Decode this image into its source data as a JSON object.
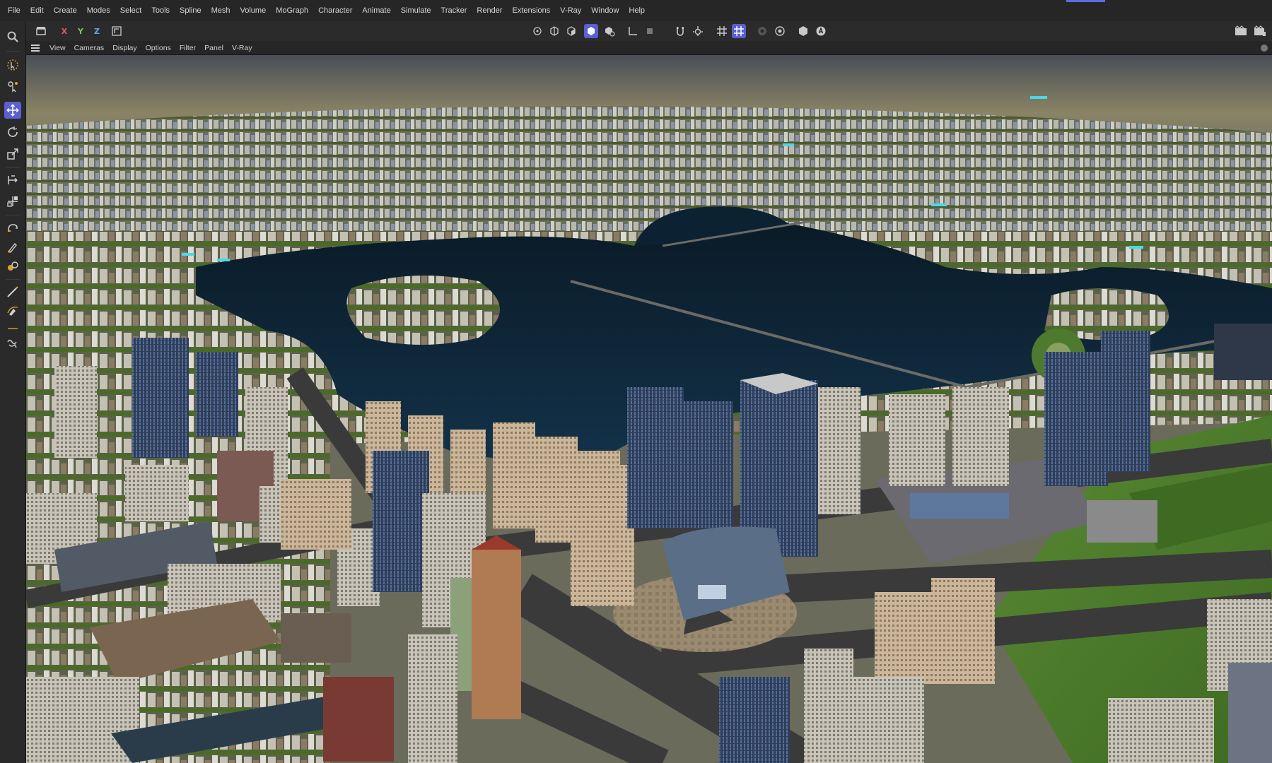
{
  "menu": [
    "File",
    "Edit",
    "Create",
    "Modes",
    "Select",
    "Tools",
    "Spline",
    "Mesh",
    "Volume",
    "MoGraph",
    "Character",
    "Animate",
    "Simulate",
    "Tracker",
    "Render",
    "Extensions",
    "V-Ray",
    "Window",
    "Help"
  ],
  "toolbar": {
    "axis_x": "X",
    "axis_y": "Y",
    "axis_z": "Z",
    "axis_colors": {
      "x": "#e05a5a",
      "y": "#7fc45a",
      "z": "#6aa3e6"
    },
    "icons_left": [
      "search-icon",
      "undo-icon",
      "coordinate-system-icon"
    ],
    "icons_center": [
      "points-mode-icon",
      "edges-mode-icon",
      "polygons-mode-icon",
      "object-mode-icon",
      "texture-mode-icon",
      "axis-mode-icon",
      "solo-icon",
      "enable-snap-icon",
      "snap-settings-icon",
      "grid-icon",
      "workplane-icon",
      "render-region-icon",
      "render-settings-icon",
      "vray-icon",
      "vray-render-icon"
    ],
    "icons_right": [
      "render-view-icon",
      "render-queue-icon"
    ]
  },
  "viewport_menu": [
    "View",
    "Cameras",
    "Display",
    "Options",
    "Filter",
    "Panel",
    "V-Ray"
  ],
  "sidebar_tools": [
    "live-selection-icon",
    "selection-tools-icon",
    "move-icon",
    "rotate-icon",
    "scale-icon",
    "transform-icon",
    "align-icon",
    "magnet-icon",
    "brush-icon",
    "paint-icon",
    "knife-icon",
    "spline-pen-icon",
    "sketch-icon",
    "smooth-icon"
  ],
  "colors": {
    "accent": "#5a5fd2",
    "water": "#0f2a3c",
    "grass": "#4f7a2c",
    "road": "#3a3a3a"
  }
}
